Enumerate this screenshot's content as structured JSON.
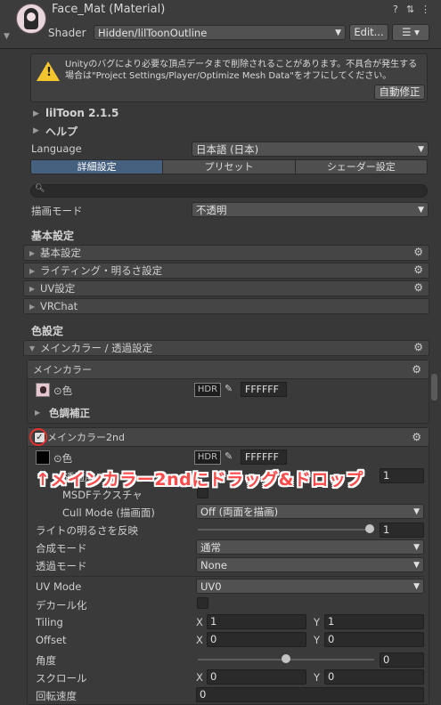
{
  "header": {
    "title": "Face_Mat (Material)",
    "shader_label": "Shader",
    "shader_value": "Hidden/lilToonOutline",
    "edit_button": "Edit..."
  },
  "warning": {
    "text": "Unityのバグにより必要な頂点データまで削除されることがあります。不具合が発生する場合は\"Project Settings/Player/Optimize Mesh Data\"をオフにしてください。",
    "fix_button": "自動修正"
  },
  "top": {
    "liltoon": "lilToon 2.1.5",
    "help": "ヘルプ",
    "language_label": "Language",
    "language_value": "日本語 (日本)",
    "tabs": [
      "詳細設定",
      "プリセット",
      "シェーダー設定"
    ],
    "render_mode_label": "描画モード",
    "render_mode_value": "不透明"
  },
  "basic": {
    "heading": "基本設定",
    "folds": [
      "基本設定",
      "ライティング・明るさ設定",
      "UV設定",
      "VRChat"
    ]
  },
  "color": {
    "heading": "色設定",
    "main_fold": "メインカラー / 透過設定",
    "main_box_title": "メインカラー",
    "color_label": "⊙色",
    "hdr": "HDR",
    "main_hex": "FFFFFF",
    "tone": "色調補正",
    "main2_title": "メインカラー2nd",
    "main2_hex": "FFFFFF",
    "alpha_partial": "透過度",
    "alpha_partial_value": "1",
    "msdf_label": "MSDFテクスチャ",
    "cull_label": "Cull Mode (描画面)",
    "cull_value": "Off (両面を描画)",
    "light_label": "ライトの明るさを反映",
    "light_value": "1",
    "light_fraction": 1.0,
    "blend_label": "合成モード",
    "blend_value": "通常",
    "trans_label": "透過モード",
    "trans_value": "None",
    "uvmode_label": "UV Mode",
    "uvmode_value": "UV0",
    "decal_label": "デカール化",
    "tiling_label": "Tiling",
    "tiling_x": "1",
    "tiling_y": "1",
    "offset_label": "Offset",
    "offset_x": "0",
    "offset_y": "0",
    "angle_label": "角度",
    "angle_value": "0",
    "angle_fraction": 0.5,
    "scroll_label": "スクロール",
    "scroll_x": "0",
    "scroll_y": "0",
    "rot_label": "回転速度",
    "rot_value": "0",
    "x": "X",
    "y": "Y"
  },
  "overlay": "↑メインカラー2ndにドラッグ&ドロップ",
  "colors": {
    "accent_tab": "#46607f",
    "warning": "#f3c52f",
    "overlay": "#ff4a4a",
    "highlight_circle": "#e03030"
  }
}
